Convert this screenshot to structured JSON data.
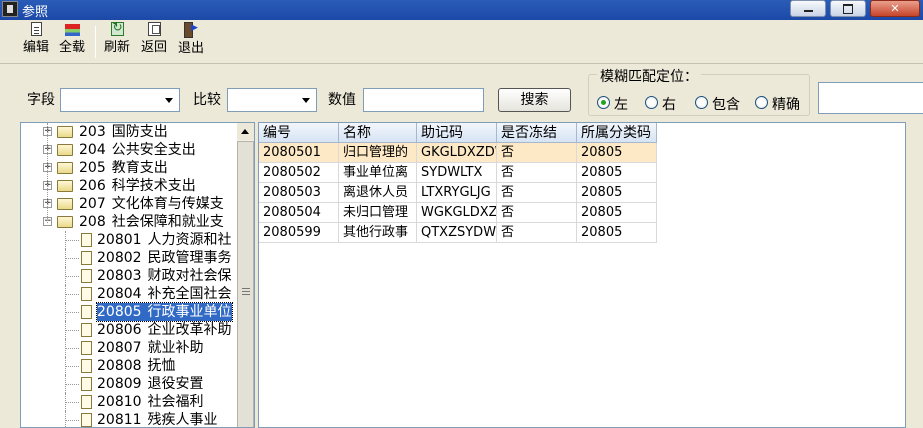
{
  "window": {
    "title": "参照"
  },
  "toolbar": {
    "edit": "编辑",
    "load_all": "全载",
    "refresh": "刷新",
    "back": "返回",
    "exit": "退出"
  },
  "search": {
    "field_label": "字段",
    "field_value": "",
    "compare_label": "比较",
    "compare_value": "",
    "value_label": "数值",
    "value_text": "",
    "search_button": "搜索"
  },
  "fuzzy": {
    "legend": "模糊匹配定位：",
    "options": [
      "左",
      "右",
      "包含",
      "精确"
    ],
    "selected": "左"
  },
  "tree": {
    "nodes": [
      {
        "code": "203",
        "name": "国防支出",
        "expanded": false,
        "level": 1
      },
      {
        "code": "204",
        "name": "公共安全支出",
        "expanded": false,
        "level": 1
      },
      {
        "code": "205",
        "name": "教育支出",
        "expanded": false,
        "level": 1
      },
      {
        "code": "206",
        "name": "科学技术支出",
        "expanded": false,
        "level": 1
      },
      {
        "code": "207",
        "name": "文化体育与传媒支",
        "expanded": false,
        "level": 1
      },
      {
        "code": "208",
        "name": "社会保障和就业支",
        "expanded": true,
        "level": 1
      },
      {
        "code": "20801",
        "name": "人力资源和社",
        "level": 2
      },
      {
        "code": "20802",
        "name": "民政管理事务",
        "level": 2
      },
      {
        "code": "20803",
        "name": "财政对社会保",
        "level": 2
      },
      {
        "code": "20804",
        "name": "补充全国社会",
        "level": 2
      },
      {
        "code": "20805",
        "name": "行政事业单位",
        "level": 2,
        "selected": true
      },
      {
        "code": "20806",
        "name": "企业改革补助",
        "level": 2
      },
      {
        "code": "20807",
        "name": "就业补助",
        "level": 2
      },
      {
        "code": "20808",
        "name": "抚恤",
        "level": 2
      },
      {
        "code": "20809",
        "name": "退役安置",
        "level": 2
      },
      {
        "code": "20810",
        "name": "社会福利",
        "level": 2
      },
      {
        "code": "20811",
        "name": "残疾人事业",
        "level": 2
      }
    ]
  },
  "grid": {
    "columns": [
      "编号",
      "名称",
      "助记码",
      "是否冻结",
      "所属分类码"
    ],
    "rows": [
      [
        "2080501",
        "归口管理的",
        "GKGLDXZDWl",
        "否",
        "20805"
      ],
      [
        "2080502",
        "事业单位离",
        "SYDWLTX",
        "否",
        "20805"
      ],
      [
        "2080503",
        "离退休人员",
        "LTXRYGLJG",
        "否",
        "20805"
      ],
      [
        "2080504",
        "未归口管理",
        "WGKGLDXZD'",
        "否",
        "20805"
      ],
      [
        "2080599",
        "其他行政事",
        "QTXZSYDWL'",
        "否",
        "20805"
      ]
    ],
    "selected_row": 0
  },
  "colors": {
    "titlebar": "#2a5db7",
    "selection": "#316ac5",
    "row_highlight": "#fde9c5",
    "window_bg": "#ece9d8"
  }
}
